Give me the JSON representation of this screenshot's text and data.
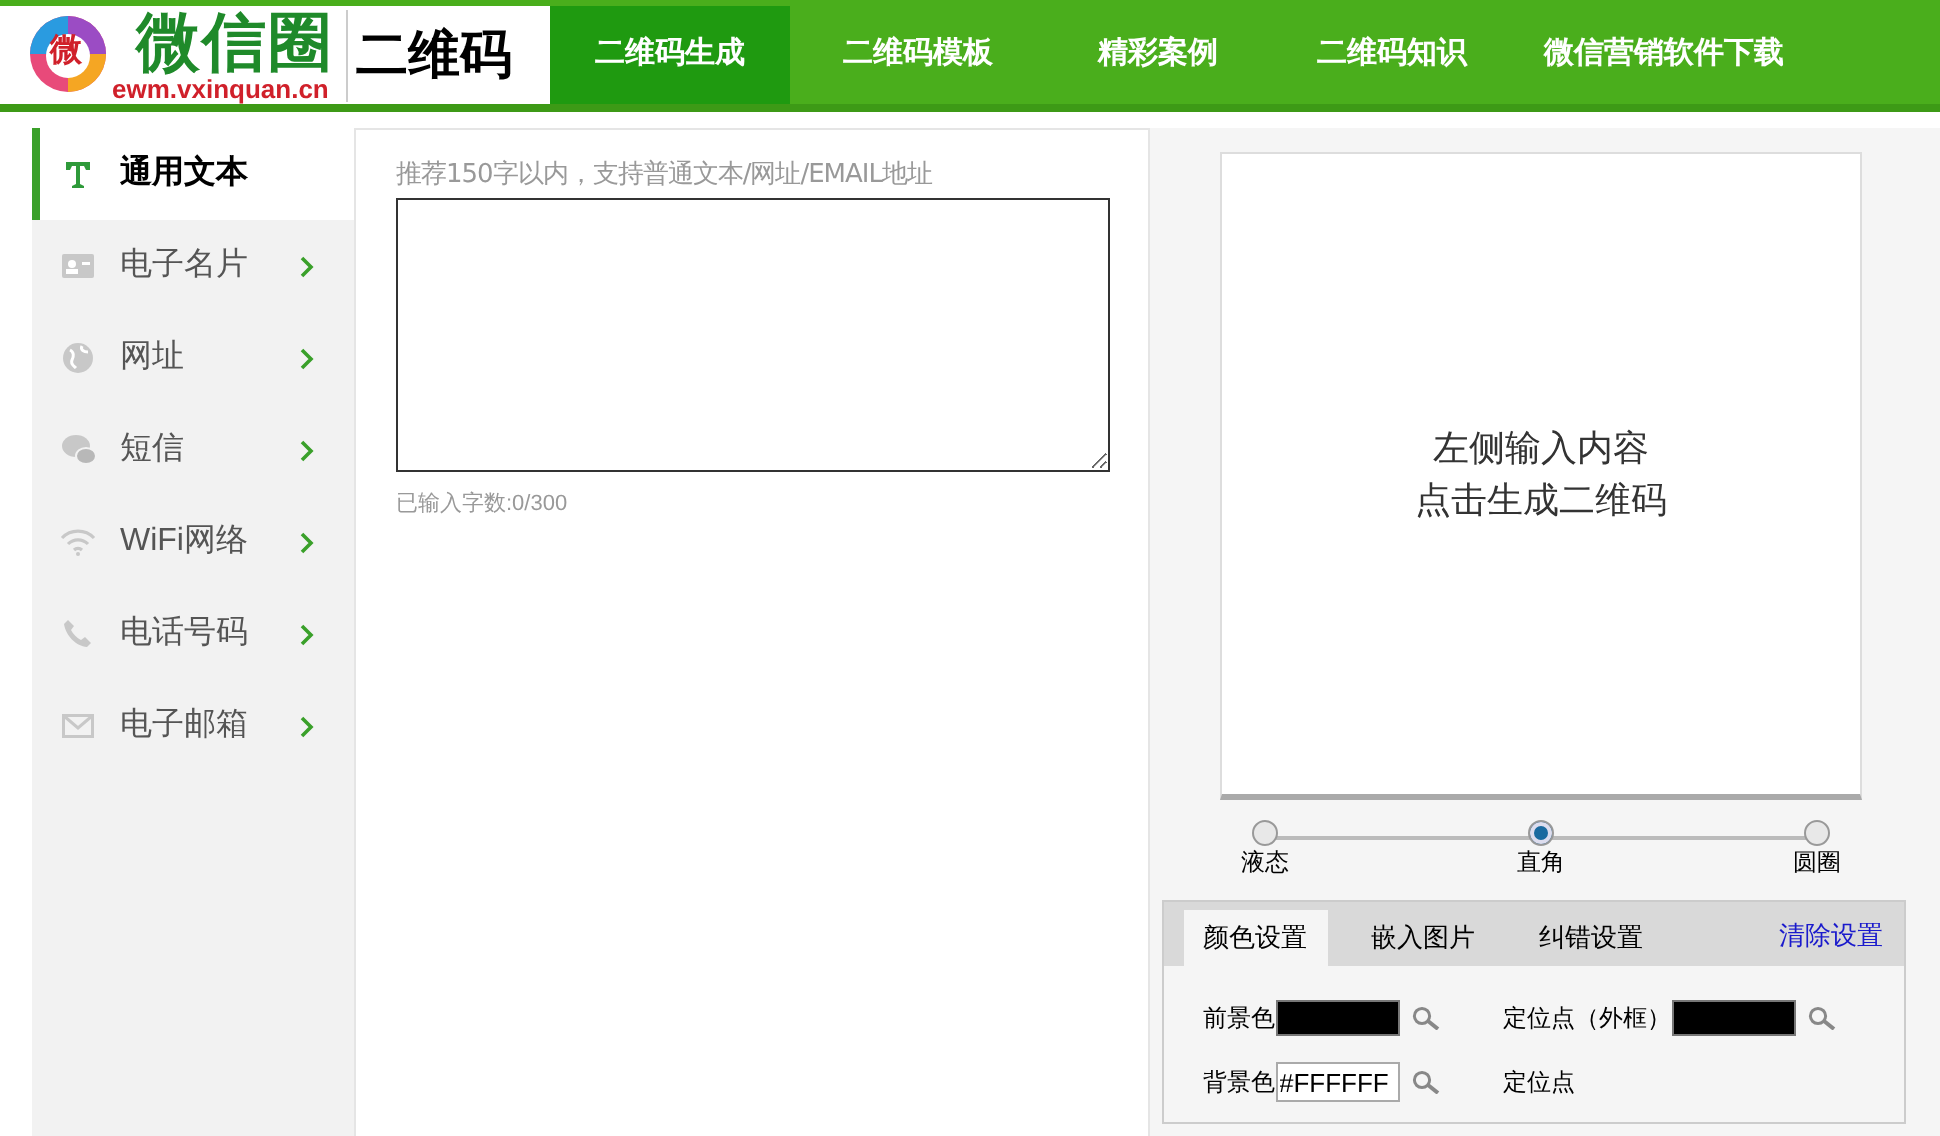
{
  "logo": {
    "title": "微信圈",
    "domain": "ewm.vxinquan.cn",
    "badge": "微"
  },
  "section_title": "二维码",
  "nav": [
    {
      "label": "二维码生成",
      "selected": true
    },
    {
      "label": "二维码模板",
      "selected": false
    },
    {
      "label": "精彩案例",
      "selected": false
    },
    {
      "label": "二维码知识",
      "selected": false
    },
    {
      "label": "微信营销软件下载",
      "selected": false
    }
  ],
  "sidebar": {
    "items": [
      {
        "label": "通用文本",
        "selected": true
      },
      {
        "label": "电子名片",
        "selected": false
      },
      {
        "label": "网址",
        "selected": false
      },
      {
        "label": "短信",
        "selected": false
      },
      {
        "label": "WiFi网络",
        "selected": false
      },
      {
        "label": "电话号码",
        "selected": false
      },
      {
        "label": "电子邮箱",
        "selected": false
      }
    ]
  },
  "editor": {
    "hint": "推荐150字以内，支持普通文本/网址/EMAIL地址",
    "counter": "已输入字数:0/300"
  },
  "preview": {
    "lines": [
      "左侧输入内容",
      "点击生成二维码"
    ]
  },
  "shape_options": [
    {
      "label": "液态",
      "selected": false
    },
    {
      "label": "直角",
      "selected": true
    },
    {
      "label": "圆圈",
      "selected": false
    }
  ],
  "settings": {
    "tabs": [
      {
        "label": "颜色设置",
        "selected": true
      },
      {
        "label": "嵌入图片",
        "selected": false
      },
      {
        "label": "纠错设置",
        "selected": false
      }
    ],
    "clear_link": "清除设置",
    "fields": [
      {
        "label": "前景色",
        "kind": "swatch",
        "color": "#000000"
      },
      {
        "label": "定位点（外框）",
        "kind": "swatch",
        "color": "#000000"
      },
      {
        "label": "背景色",
        "kind": "text",
        "value": "#FFFFFF"
      },
      {
        "label": "定位点",
        "kind": "hidden"
      }
    ]
  }
}
